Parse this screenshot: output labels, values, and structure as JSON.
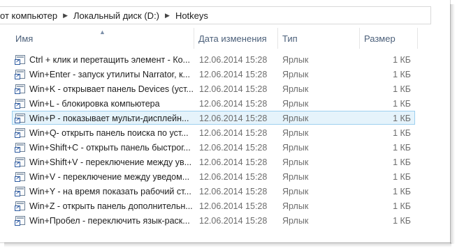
{
  "address": {
    "crumbs": [
      "от компьютер",
      "Локальный диск (D:)",
      "Hotkeys"
    ]
  },
  "columns": {
    "name": "Имя",
    "date": "Дата изменения",
    "type": "Тип",
    "size": "Размер"
  },
  "files": [
    {
      "name": "Ctrl + клик и перетащить элемент - Ко...",
      "date": "12.06.2014 15:28",
      "type": "Ярлык",
      "size": "1 КБ"
    },
    {
      "name": "Win+Enter - запуск утилиты Narrator, к...",
      "date": "12.06.2014 15:28",
      "type": "Ярлык",
      "size": "1 КБ"
    },
    {
      "name": "Win+K - открывает панель Devices (уст...",
      "date": "12.06.2014 15:28",
      "type": "Ярлык",
      "size": "1 КБ"
    },
    {
      "name": "Win+L - блокировка компьютера",
      "date": "12.06.2014 15:28",
      "type": "Ярлык",
      "size": "1 КБ"
    },
    {
      "name": "Win+P - показывает мульти-дисплейн...",
      "date": "12.06.2014 15:28",
      "type": "Ярлык",
      "size": "1 КБ"
    },
    {
      "name": "Win+Q- открыть панель поиска по уст...",
      "date": "12.06.2014 15:28",
      "type": "Ярлык",
      "size": "1 КБ"
    },
    {
      "name": "Win+Shift+C - открыть панель быстрог...",
      "date": "12.06.2014 15:28",
      "type": "Ярлык",
      "size": "1 КБ"
    },
    {
      "name": "Win+Shift+V - переключение между ув...",
      "date": "12.06.2014 15:28",
      "type": "Ярлык",
      "size": "1 КБ"
    },
    {
      "name": "Win+V - переключение между уведом...",
      "date": "12.06.2014 15:28",
      "type": "Ярлык",
      "size": "1 КБ"
    },
    {
      "name": "Win+Y - на время показать рабочий ст...",
      "date": "12.06.2014 15:28",
      "type": "Ярлык",
      "size": "1 КБ"
    },
    {
      "name": "Win+Z - открыть панель дополнительн...",
      "date": "12.06.2014 15:28",
      "type": "Ярлык",
      "size": "1 КБ"
    },
    {
      "name": "Win+Пробел - переключить язык-раск...",
      "date": "12.06.2014 15:28",
      "type": "Ярлык",
      "size": "1 КБ"
    }
  ],
  "selected_row": 4,
  "colors": {
    "header_text": "#4c607a",
    "selection_fill": "#e5f3fb",
    "selection_border": "#9dd0ef"
  },
  "icons": {
    "breadcrumb_separator": "chevron-right-icon",
    "sort_indicator": "sort-ascending-icon",
    "file": "shortcut-file-icon"
  }
}
